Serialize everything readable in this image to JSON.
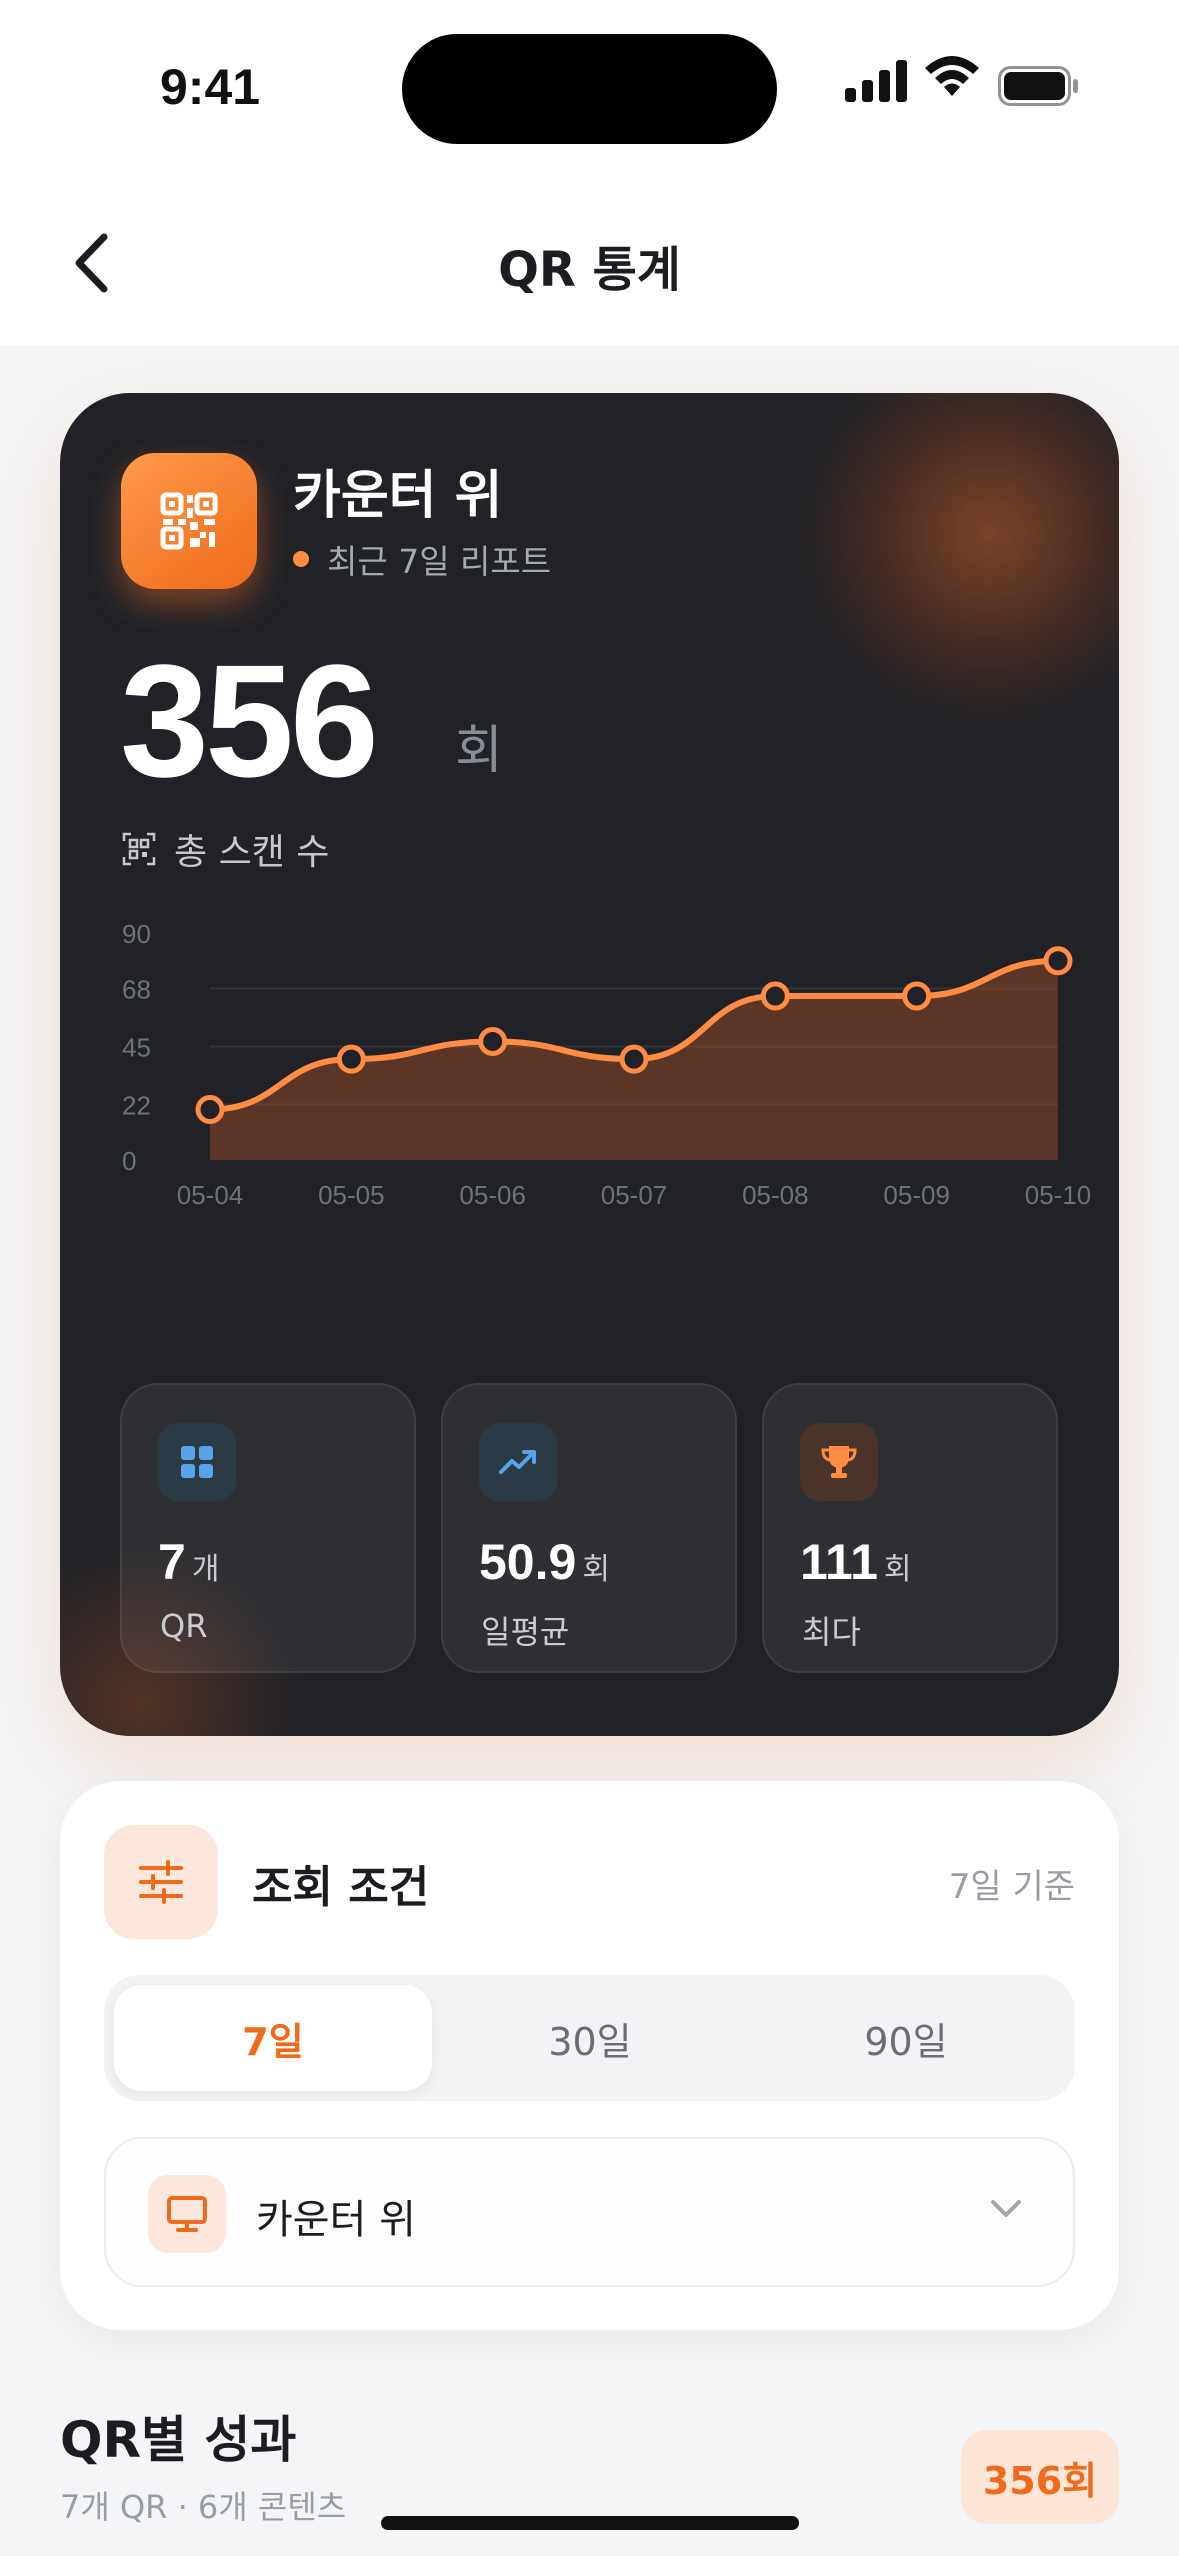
{
  "status": {
    "time": "9:41"
  },
  "nav": {
    "title": "QR 통계"
  },
  "hero": {
    "title": "카운터 위",
    "subtitle": "최근 7일 리포트",
    "total_value": "356",
    "total_unit": "회",
    "total_label": "총 스캔 수",
    "accent": "#ff8c42"
  },
  "chart_data": {
    "type": "area",
    "x": [
      "05-04",
      "05-05",
      "05-06",
      "05-07",
      "05-08",
      "05-09",
      "05-10"
    ],
    "series": [
      {
        "values": [
          20,
          40,
          47,
          40,
          65,
          65,
          79
        ]
      }
    ],
    "yticks": [
      "0",
      "22",
      "45",
      "68",
      "90"
    ],
    "ylim": [
      0,
      90
    ],
    "grid": true,
    "color": "#ff8c42"
  },
  "stats": [
    {
      "value": "7",
      "unit": "개",
      "label": "QR",
      "icon": "grid-icon"
    },
    {
      "value": "50.9",
      "unit": "회",
      "label": "일평균",
      "icon": "trend-up-icon"
    },
    {
      "value": "111",
      "unit": "회",
      "label": "최다",
      "icon": "trophy-icon"
    }
  ],
  "filter": {
    "title": "조회 조건",
    "basis": "7일 기준",
    "periods": [
      "7일",
      "30일",
      "90일"
    ],
    "selected_period": "7일",
    "select_value": "카운터 위"
  },
  "section": {
    "title": "QR별 성과",
    "subtitle": "7개 QR · 6개 콘텐츠",
    "badge": "356회"
  }
}
